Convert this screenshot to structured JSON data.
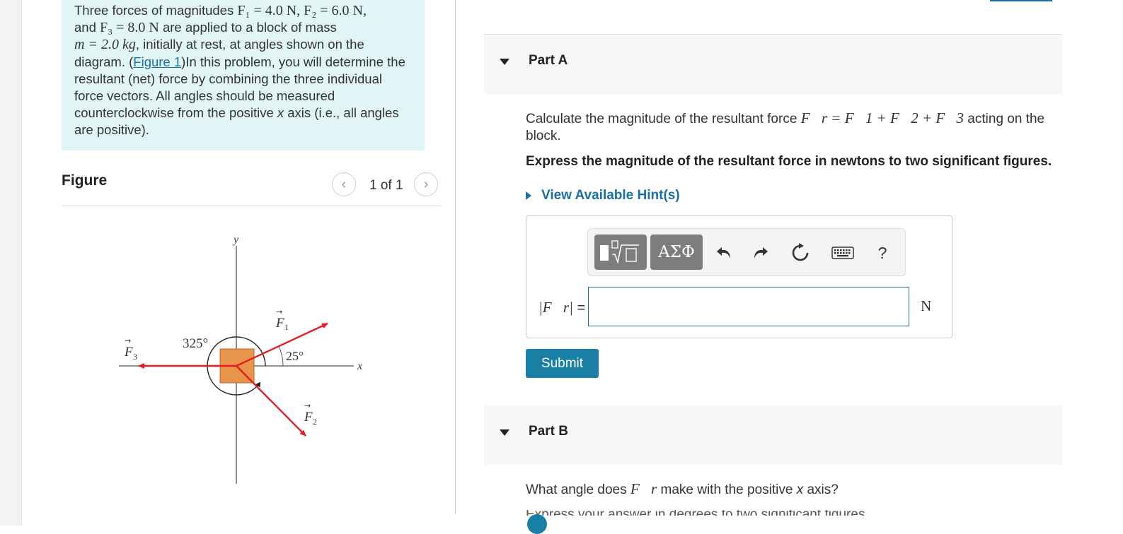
{
  "problem": {
    "text_1": "Three forces of magnitudes ",
    "f1_eq": "F₁ = 4.0 N",
    "sep_1": ", ",
    "f2_eq": "F₂ = 6.0 N",
    "sep_2": ",",
    "text_2": "and ",
    "f3_eq": "F₃ = 8.0 N",
    "text_3": " are applied to a block of mass",
    "m_eq": "m = 2.0 kg",
    "text_4": ", initially at rest, at angles shown on the diagram. (",
    "figure_link": "Figure 1",
    "text_5": ")In this problem, you will determine the resultant (net) force by combining the three individual force vectors. All angles should be measured counterclockwise from the positive ",
    "axis_var": "x",
    "text_6": " axis (i.e., all angles are positive)."
  },
  "figure_panel": {
    "title": "Figure",
    "pager_prev": "‹",
    "pager_next": "›",
    "pager_text": "1 of 1"
  },
  "diagram": {
    "y_axis_label": "y",
    "x_axis_label": "x",
    "angle_325_label": "325°",
    "angle_25_label": "25°",
    "f1_label": "F",
    "f1_sub": "1",
    "f2_label": "F",
    "f2_sub": "2",
    "f3_label": "F",
    "f3_sub": "3",
    "arrow_mark": "→",
    "colors": {
      "arrow": "#e31e24",
      "block": "#e8944a",
      "axis": "#6d6d6d"
    }
  },
  "part_a": {
    "label": "Part A",
    "question_prefix": "Calculate the magnitude of the resultant force ",
    "question_math": "F⃗r = F⃗1 + F⃗2 + F⃗3",
    "question_suffix": " acting on the block.",
    "instruction": "Express the magnitude of the resultant force in newtons to two significant figures.",
    "hint_label": "View Available Hint(s)",
    "answer_label_math": "|F⃗r|",
    "answer_label_eq": " =",
    "answer_value": "",
    "unit": "N",
    "submit_label": "Submit",
    "toolbar": {
      "template_icon": "template-icon",
      "greek_label": "ΑΣΦ",
      "undo_icon": "undo-icon",
      "redo_icon": "redo-icon",
      "reset_icon": "reset-icon",
      "keyboard_icon": "keyboard-icon",
      "help_label": "?"
    }
  },
  "part_b": {
    "label": "Part B",
    "question_prefix": "What angle does ",
    "question_math": "F⃗r",
    "question_mid": " make with the positive ",
    "axis_var": "x",
    "question_suffix": " axis?",
    "instruction_partial": "Express your answer in degrees to two significant figures."
  },
  "theme": {
    "accent": "#1a7fa4",
    "link": "#1a6fa6",
    "problem_bg": "#e2f5f6",
    "part_bg": "#f7f7f7"
  }
}
